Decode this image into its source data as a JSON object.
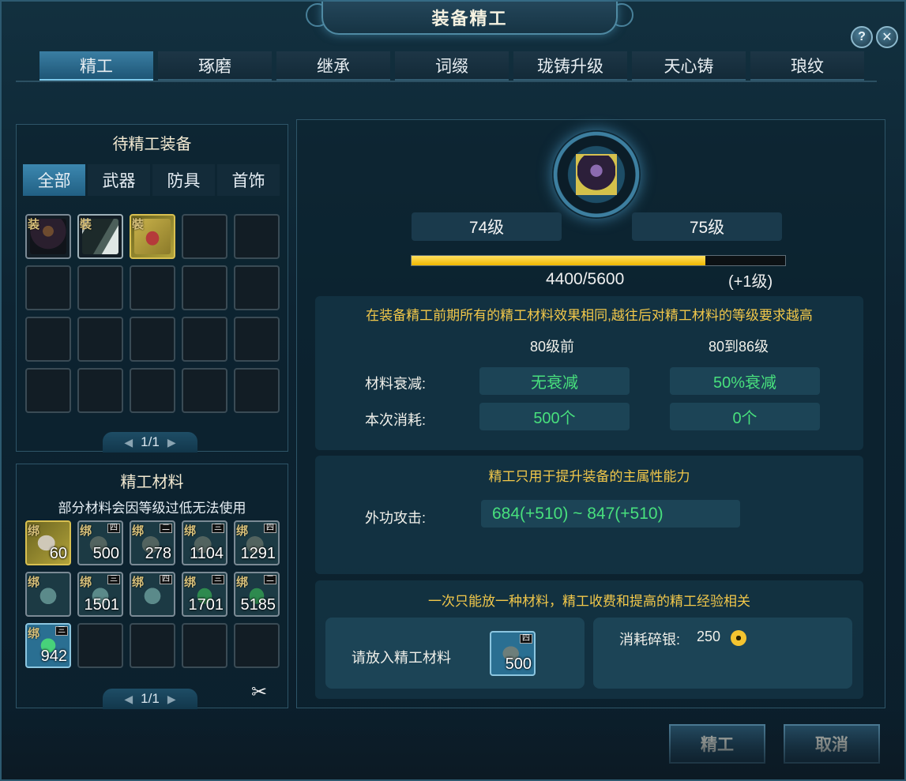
{
  "window": {
    "title": "装备精工"
  },
  "tabs": [
    "精工",
    "琢磨",
    "继承",
    "词缀",
    "珑铸升级",
    "天心铸",
    "琅纹"
  ],
  "top_buttons": {
    "help": "?",
    "close": "✕"
  },
  "equipment_panel": {
    "title": "待精工装备",
    "filters": [
      "全部",
      "武器",
      "防具",
      "首饰"
    ],
    "items": [
      {
        "tag": "装",
        "icon": "hooded-figure-icon"
      },
      {
        "tag": "裝",
        "icon": "dark-cloak-icon"
      },
      {
        "tag": "裝",
        "icon": "red-bracelet-icon"
      }
    ],
    "page": "1/1"
  },
  "materials_panel": {
    "title": "精工材料",
    "subtitle": "部分材料会因等级过低无法使用",
    "items": [
      {
        "tag": "绑",
        "tier": "",
        "qty": "60",
        "icon": "stone-icon",
        "selected": true
      },
      {
        "tag": "绑",
        "tier": "四",
        "qty": "500",
        "icon": "stone-icon"
      },
      {
        "tag": "绑",
        "tier": "二",
        "qty": "278",
        "icon": "stone-icon"
      },
      {
        "tag": "绑",
        "tier": "三",
        "qty": "1104",
        "icon": "stone-icon"
      },
      {
        "tag": "绑",
        "tier": "四",
        "qty": "1291",
        "icon": "stone-icon"
      },
      {
        "tag": "绑",
        "tier": "",
        "qty": "",
        "icon": "jade-icon"
      },
      {
        "tag": "绑",
        "tier": "三",
        "qty": "1501",
        "icon": "jade-icon"
      },
      {
        "tag": "绑",
        "tier": "四",
        "qty": "",
        "icon": "jade-icon"
      },
      {
        "tag": "绑",
        "tier": "三",
        "qty": "1701",
        "icon": "green-crystal-icon"
      },
      {
        "tag": "绑",
        "tier": "二",
        "qty": "5185",
        "icon": "green-crystal-icon"
      },
      {
        "tag": "绑",
        "tier": "三",
        "qty": "942",
        "icon": "green-crystal-icon"
      }
    ],
    "page": "1/1"
  },
  "refine": {
    "current_level": "74级",
    "next_level": "75级",
    "exp_text": "4400/5600",
    "exp_progress": 0.786,
    "level_gain": "(+1级)",
    "tip": "在装备精工前期所有的精工材料效果相同,越往后对精工材料的等级要求越高",
    "col1": "80级前",
    "col2": "80到86级",
    "decay_label": "材料衰减:",
    "decay_val1": "无衰减",
    "decay_val2": "50%衰减",
    "cost_label": "本次消耗:",
    "cost_val1": "500个",
    "cost_val2": "0个"
  },
  "attribute": {
    "tip": "精工只用于提升装备的主属性能力",
    "label": "外功攻击:",
    "value": "684(+510) ~ 847(+510)"
  },
  "material_slot": {
    "tip": "一次只能放一种材料，精工收费和提高的精工经验相关",
    "label": "请放入精工材料",
    "tier": "四",
    "qty": "500",
    "cost_label": "消耗碎银:",
    "cost_value": "250"
  },
  "actions": {
    "confirm": "精工",
    "cancel": "取消"
  },
  "colors": {
    "accent": "#48e07d",
    "gold": "#f2c84a",
    "exp_bar": "#f0b800"
  }
}
